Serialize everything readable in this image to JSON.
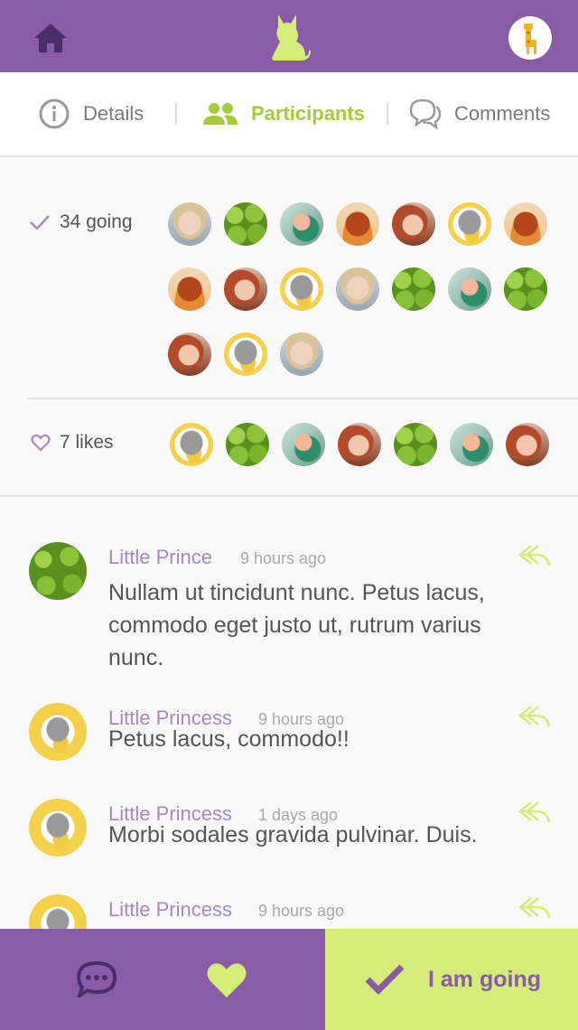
{
  "colors": {
    "purple": "#8a5ca8",
    "lime": "#a4cb3a",
    "lime_light": "#d6ec79"
  },
  "header": {
    "home_icon": "home-icon",
    "logo_icon": "cat-icon",
    "avatar_icon": "giraffe-icon"
  },
  "tabs": [
    {
      "label": "Details",
      "icon": "info-icon",
      "active": false
    },
    {
      "label": "Participants",
      "icon": "people-icon",
      "active": true
    },
    {
      "label": "Comments",
      "icon": "speech-bubbles-icon",
      "active": false
    }
  ],
  "participants": {
    "going_label": "34 going",
    "going_avatars": [
      "blonde",
      "lime",
      "bird",
      "fox",
      "red",
      "hamster",
      "fox",
      "fox",
      "red",
      "hamster",
      "blonde",
      "lime",
      "bird",
      "lime",
      "red",
      "hamster",
      "blonde"
    ],
    "likes_label": "7 likes",
    "like_avatars": [
      "hamster",
      "lime",
      "bird",
      "red",
      "lime",
      "bird",
      "red"
    ]
  },
  "comments": [
    {
      "name": "Little Prince",
      "time": "9 hours ago",
      "text": "Nullam ut tincidunt nunc. Petus lacus, commodo eget justo ut, rutrum varius nunc.",
      "avatar": "lime"
    },
    {
      "name": "Little Princess",
      "time": "9 hours ago",
      "text": "Petus lacus, commodo!!",
      "avatar": "hamster"
    },
    {
      "name": "Little Princess",
      "time": "1 days ago",
      "text": "Morbi sodales gravida pulvinar. Duis.",
      "avatar": "hamster"
    },
    {
      "name": "Little Princess",
      "time": "9 hours ago",
      "text": "",
      "avatar": "hamster"
    }
  ],
  "bottom": {
    "going_label": "I am going",
    "chat_icon": "chat-icon",
    "heart_icon": "heart-icon",
    "check_icon": "check-icon"
  }
}
